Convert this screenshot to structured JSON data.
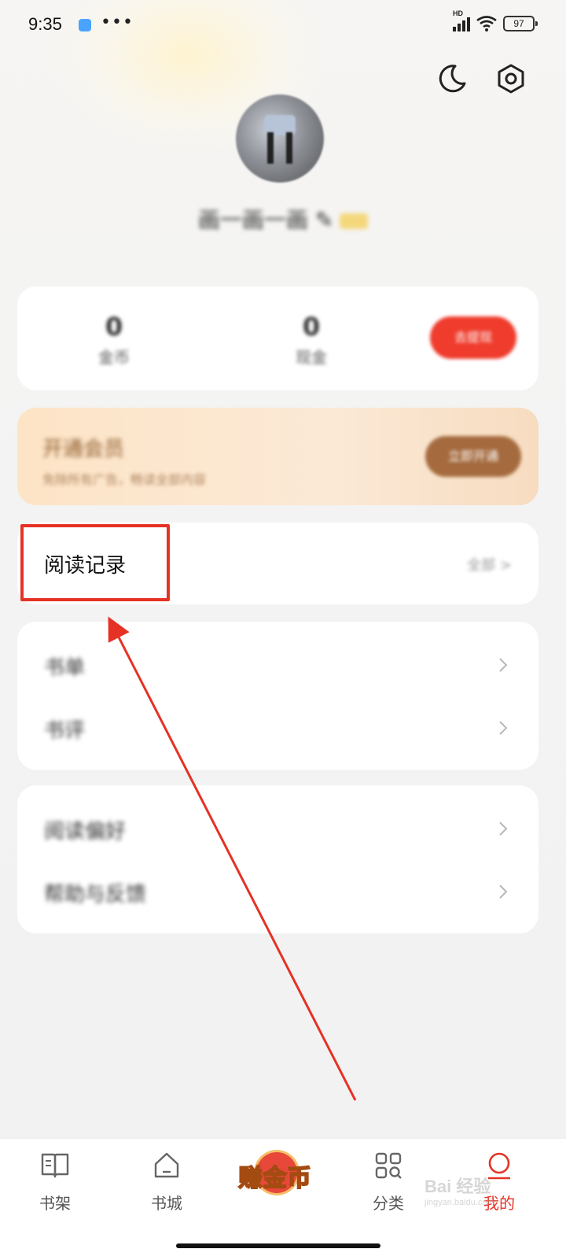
{
  "status_bar": {
    "time": "9:35",
    "dots": "•••",
    "network": "HD",
    "battery": "97"
  },
  "header": {
    "moon_icon": "moon-icon",
    "settings_icon": "gear-icon"
  },
  "profile": {
    "username": "画一画一画 ✎"
  },
  "stats": [
    {
      "value": "0",
      "label": "金币"
    },
    {
      "value": "0",
      "label": "现金"
    }
  ],
  "stats_button": "去提现",
  "vip": {
    "title": "开通会员",
    "subtitle": "免除所有广告，畅读全部内容",
    "button": "立即开通"
  },
  "reading_record": {
    "label": "阅读记录",
    "right_text": "全部 >"
  },
  "group1": [
    {
      "label": "书单"
    },
    {
      "label": "书评"
    }
  ],
  "group2": [
    {
      "label": "阅读偏好"
    },
    {
      "label": "帮助与反馈"
    }
  ],
  "tabbar": {
    "items": [
      {
        "label": "书架",
        "icon": "bookshelf-icon"
      },
      {
        "label": "书城",
        "icon": "home-icon"
      },
      {
        "label": "分类",
        "icon": "category-icon"
      },
      {
        "label": "我的",
        "icon": "profile-icon"
      }
    ],
    "earn_label": "赚金币"
  },
  "watermark": {
    "main": "Bai 经验",
    "sub": "jingyan.baidu.com"
  },
  "colors": {
    "accent": "#e53224",
    "vip_brown": "#a56b3f",
    "red_button": "#ef3c2d"
  }
}
